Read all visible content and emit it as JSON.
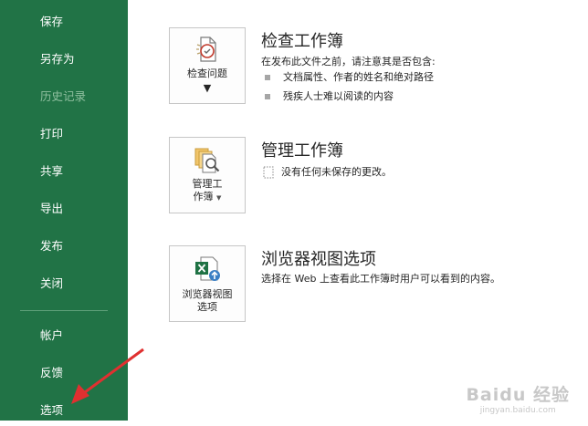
{
  "sidebar": {
    "items": [
      {
        "label": "保存"
      },
      {
        "label": "另存为"
      },
      {
        "label": "历史记录"
      },
      {
        "label": "打印"
      },
      {
        "label": "共享"
      },
      {
        "label": "导出"
      },
      {
        "label": "发布"
      },
      {
        "label": "关闭"
      }
    ],
    "bottom_items": [
      {
        "label": "帐户"
      },
      {
        "label": "反馈"
      },
      {
        "label": "选项"
      }
    ],
    "background": "#217346"
  },
  "sections": {
    "inspect": {
      "button_label": "检查问题",
      "title": "检查工作簿",
      "description": "在发布此文件之前，请注意其是否包含:",
      "bullets": [
        "文档属性、作者的姓名和绝对路径",
        "残疾人士难以阅读的内容"
      ]
    },
    "manage": {
      "button_label_line1": "管理工",
      "button_label_line2": "作簿",
      "title": "管理工作簿",
      "status": "没有任何未保存的更改。"
    },
    "browser": {
      "button_label_line1": "浏览器视图",
      "button_label_line2": "选项",
      "title": "浏览器视图选项",
      "description": "选择在 Web 上查看此工作簿时用户可以看到的内容。"
    }
  },
  "watermark": {
    "logo": "Baidu 经验",
    "url": "jingyan.baidu.com"
  },
  "annotation": {
    "arrow_color": "#e03030"
  }
}
